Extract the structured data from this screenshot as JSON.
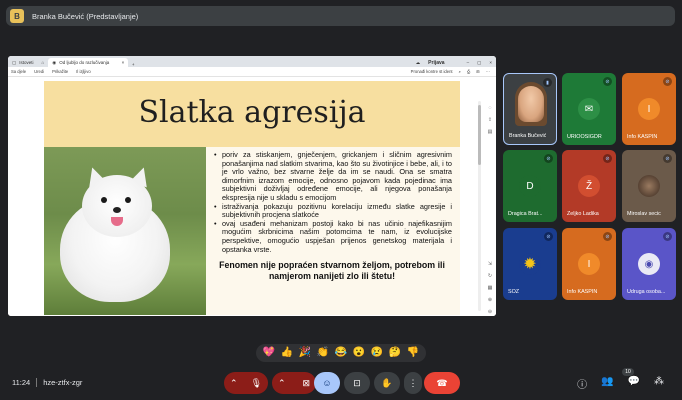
{
  "presenter": {
    "avatar_letter": "B",
    "label": "Branka Bučević (Predstavljanje)"
  },
  "browser": {
    "tabs": [
      {
        "label": "Istoveti"
      },
      {
        "label": "Od ljubljo do razlučivanja"
      }
    ],
    "active_tab": "Od ljubljo do razlučivanja",
    "right_label": "Prijava",
    "toolbar_items": [
      "Sa djele",
      "Uredi",
      "Prikažite",
      "Il izjljivo"
    ],
    "toolbar_right": "Pronađi kontre st ident"
  },
  "slide": {
    "title": "Slatka agresija",
    "bullets": [
      "poriv za stiskanjem, gnječenjem, grickanjem i sličnim agresivnim ponašanjima nad slatkim stvarima, kao što su životinjice i bebe, ali, i to je vrlo važno, bez stvarne želje da im se naudi. Ona se smatra dimorfnim izrazom emocije, odnosno pojavom kada pojedinac ima subjektivni doživljaj određene emocije, ali njegova ponašanja ekspresija nije u skladu s emocijom",
      "istraživanja pokazuju pozitivnu korelaciju između slatke agresije i subjektivnih procjena slatkoće",
      "ovaj usađeni mehanizam postoji kako bi nas učinio najefikasnijim mogućim skrbnicima našim potomcima te nam, iz evolucijske perspektive, omogućio uspješan prijenos genetskog materijala i opstanka vrste."
    ],
    "conclusion": "Fenomen nije popraćen stvarnom željom, potrebom ili namjerom nanijeti zlo ili štetu!"
  },
  "participants": [
    {
      "name": "Branka Bučević",
      "initial": "",
      "bg": "#3c4043"
    },
    {
      "name": "URIOOSIGDR",
      "initial": "✉",
      "bg": "#1e7a37"
    },
    {
      "name": "Info KASPIN",
      "initial": "I",
      "bg": "#d66b1f"
    },
    {
      "name": "Dragica Brat...",
      "initial": "D",
      "bg": "#1e6b2f"
    },
    {
      "name": "Željko Ladika",
      "initial": "Ž",
      "bg": "#b33a27"
    },
    {
      "name": "Miroslav secic",
      "initial": "",
      "bg": "#6b5a4a"
    },
    {
      "name": "SOZ",
      "initial": "✹",
      "bg": "#1a3d8f"
    },
    {
      "name": "Info KASPIN",
      "initial": "I",
      "bg": "#d66b1f"
    },
    {
      "name": "Udruga osoba...",
      "initial": "◉",
      "bg": "#5a55c8"
    }
  ],
  "reactions": [
    "💖",
    "👍",
    "🎉",
    "👏",
    "😂",
    "😮",
    "😢",
    "🤔",
    "👎"
  ],
  "meeting": {
    "time": "11:24",
    "code": "hze-ztfx-zgr",
    "participant_count": "10"
  }
}
